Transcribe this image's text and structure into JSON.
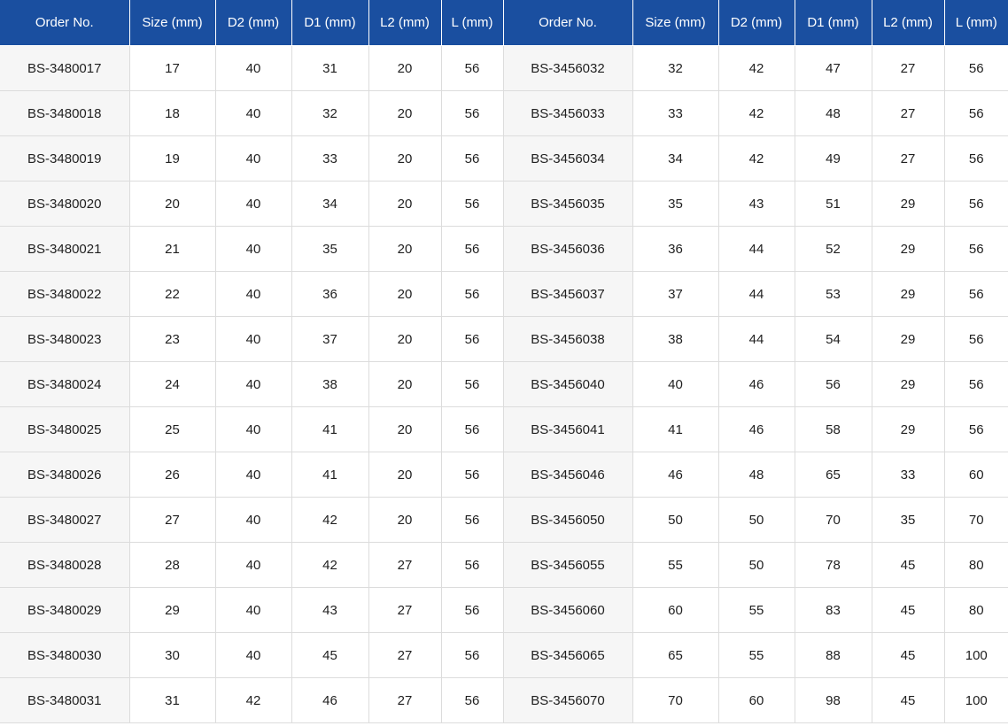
{
  "table": {
    "headers": [
      "Order No.",
      "Size (mm)",
      "D2 (mm)",
      "D1 (mm)",
      "L2 (mm)",
      "L (mm)",
      "Order No.",
      "Size (mm)",
      "D2 (mm)",
      "D1 (mm)",
      "L2 (mm)",
      "L (mm)"
    ],
    "rows": [
      [
        "BS-3480017",
        "17",
        "40",
        "31",
        "20",
        "56",
        "BS-3456032",
        "32",
        "42",
        "47",
        "27",
        "56"
      ],
      [
        "BS-3480018",
        "18",
        "40",
        "32",
        "20",
        "56",
        "BS-3456033",
        "33",
        "42",
        "48",
        "27",
        "56"
      ],
      [
        "BS-3480019",
        "19",
        "40",
        "33",
        "20",
        "56",
        "BS-3456034",
        "34",
        "42",
        "49",
        "27",
        "56"
      ],
      [
        "BS-3480020",
        "20",
        "40",
        "34",
        "20",
        "56",
        "BS-3456035",
        "35",
        "43",
        "51",
        "29",
        "56"
      ],
      [
        "BS-3480021",
        "21",
        "40",
        "35",
        "20",
        "56",
        "BS-3456036",
        "36",
        "44",
        "52",
        "29",
        "56"
      ],
      [
        "BS-3480022",
        "22",
        "40",
        "36",
        "20",
        "56",
        "BS-3456037",
        "37",
        "44",
        "53",
        "29",
        "56"
      ],
      [
        "BS-3480023",
        "23",
        "40",
        "37",
        "20",
        "56",
        "BS-3456038",
        "38",
        "44",
        "54",
        "29",
        "56"
      ],
      [
        "BS-3480024",
        "24",
        "40",
        "38",
        "20",
        "56",
        "BS-3456040",
        "40",
        "46",
        "56",
        "29",
        "56"
      ],
      [
        "BS-3480025",
        "25",
        "40",
        "41",
        "20",
        "56",
        "BS-3456041",
        "41",
        "46",
        "58",
        "29",
        "56"
      ],
      [
        "BS-3480026",
        "26",
        "40",
        "41",
        "20",
        "56",
        "BS-3456046",
        "46",
        "48",
        "65",
        "33",
        "60"
      ],
      [
        "BS-3480027",
        "27",
        "40",
        "42",
        "20",
        "56",
        "BS-3456050",
        "50",
        "50",
        "70",
        "35",
        "70"
      ],
      [
        "BS-3480028",
        "28",
        "40",
        "42",
        "27",
        "56",
        "BS-3456055",
        "55",
        "50",
        "78",
        "45",
        "80"
      ],
      [
        "BS-3480029",
        "29",
        "40",
        "43",
        "27",
        "56",
        "BS-3456060",
        "60",
        "55",
        "83",
        "45",
        "80"
      ],
      [
        "BS-3480030",
        "30",
        "40",
        "45",
        "27",
        "56",
        "BS-3456065",
        "65",
        "55",
        "88",
        "45",
        "100"
      ],
      [
        "BS-3480031",
        "31",
        "42",
        "46",
        "27",
        "56",
        "BS-3456070",
        "70",
        "60",
        "98",
        "45",
        "100"
      ]
    ]
  },
  "colors": {
    "header_bg": "#1a4fa0",
    "header_text": "#ffffff",
    "order_cell_bg": "#f6f6f6",
    "grid_line": "#dcdcdc"
  }
}
